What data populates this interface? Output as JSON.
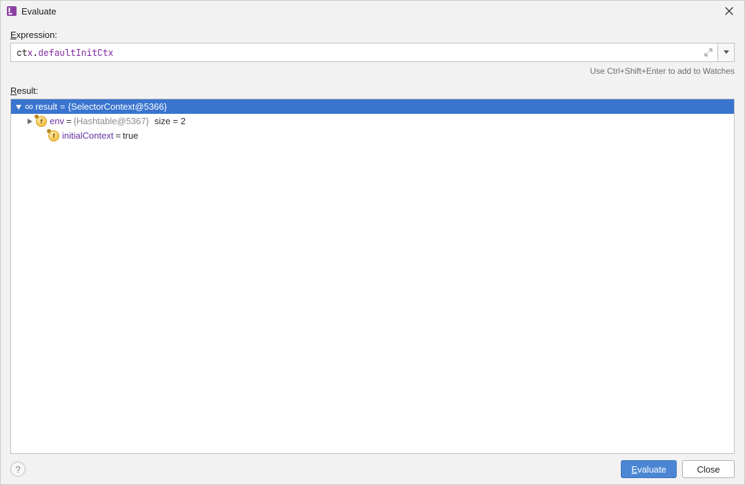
{
  "window": {
    "title": "Evaluate"
  },
  "labels": {
    "expression": "Expression:",
    "result": "Result:",
    "hint": "Use Ctrl+Shift+Enter to add to Watches"
  },
  "expression": {
    "tokens": [
      {
        "text": "ct",
        "cls": "tok-dark"
      },
      {
        "text": "x",
        "cls": "tok-purple"
      },
      {
        "text": ".",
        "cls": "tok-dark"
      },
      {
        "text": "defaultInitCt",
        "cls": "tok-purple"
      },
      {
        "text": "x",
        "cls": "tok-purple"
      }
    ]
  },
  "result": {
    "root": {
      "name": "result",
      "valueType": "{SelectorContext@5366}",
      "children": [
        {
          "name": "env",
          "valueType": "{Hashtable@5367}",
          "suffix": "size = 2",
          "hasChildren": true
        },
        {
          "name": "initialContext",
          "value": "true",
          "hasChildren": false
        }
      ]
    }
  },
  "buttons": {
    "evaluate": "Evaluate",
    "close": "Close",
    "help": "?"
  }
}
